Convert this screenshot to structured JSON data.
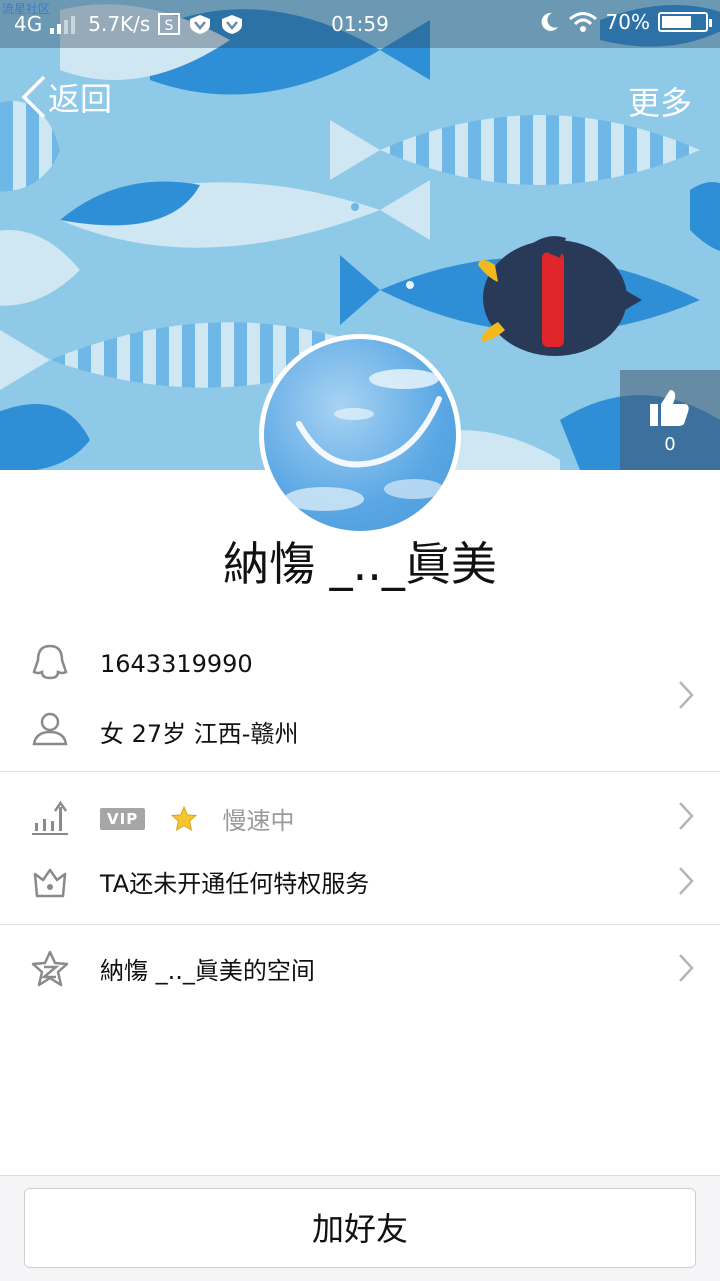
{
  "status_bar": {
    "watermark": "流星社区",
    "network": "4G",
    "speed": "5.7K/s",
    "time": "01:59",
    "battery_percent": "70%",
    "battery_level": 0.7
  },
  "header": {
    "back_label": "返回",
    "more_label": "更多",
    "like_count": "0"
  },
  "profile": {
    "nickname": "納慯 _.._眞美"
  },
  "info": {
    "qq_number": "1643319990",
    "gender_age_location": "女  27岁  江西-赣州"
  },
  "vip": {
    "badge": "VIP",
    "status": "慢速中"
  },
  "privilege": {
    "text": "TA还未开通任何特权服务"
  },
  "qzone": {
    "text": "納慯 _.._眞美的空间"
  },
  "actions": {
    "add_friend": "加好友"
  },
  "colors": {
    "header_bg": "#8fc9e8",
    "fish_blue": "#2f8fd6",
    "penguin": "#283a57",
    "scarf": "#e0262b"
  }
}
